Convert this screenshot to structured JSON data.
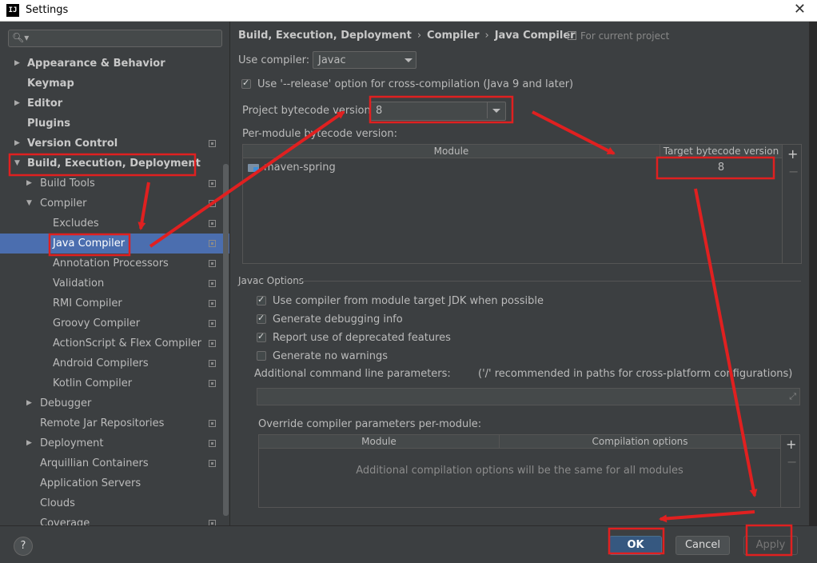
{
  "window": {
    "title": "Settings",
    "app_icon": "IJ"
  },
  "sidebar": {
    "search_placeholder": "",
    "items": [
      {
        "label": "Appearance & Behavior",
        "level": 0,
        "arrow": "right",
        "bold": true,
        "proj": false
      },
      {
        "label": "Keymap",
        "level": 0,
        "arrow": "",
        "bold": true,
        "proj": false
      },
      {
        "label": "Editor",
        "level": 0,
        "arrow": "right",
        "bold": true,
        "proj": false
      },
      {
        "label": "Plugins",
        "level": 0,
        "arrow": "",
        "bold": true,
        "proj": false
      },
      {
        "label": "Version Control",
        "level": 0,
        "arrow": "right",
        "bold": true,
        "proj": true
      },
      {
        "label": "Build, Execution, Deployment",
        "level": 0,
        "arrow": "down",
        "bold": true,
        "proj": false
      },
      {
        "label": "Build Tools",
        "level": 1,
        "arrow": "right",
        "bold": false,
        "proj": true
      },
      {
        "label": "Compiler",
        "level": 1,
        "arrow": "down",
        "bold": false,
        "proj": true
      },
      {
        "label": "Excludes",
        "level": 2,
        "arrow": "",
        "bold": false,
        "proj": true
      },
      {
        "label": "Java Compiler",
        "level": 2,
        "arrow": "",
        "bold": false,
        "proj": true,
        "selected": true
      },
      {
        "label": "Annotation Processors",
        "level": 2,
        "arrow": "",
        "bold": false,
        "proj": true
      },
      {
        "label": "Validation",
        "level": 2,
        "arrow": "",
        "bold": false,
        "proj": true
      },
      {
        "label": "RMI Compiler",
        "level": 2,
        "arrow": "",
        "bold": false,
        "proj": true
      },
      {
        "label": "Groovy Compiler",
        "level": 2,
        "arrow": "",
        "bold": false,
        "proj": true
      },
      {
        "label": "ActionScript & Flex Compiler",
        "level": 2,
        "arrow": "",
        "bold": false,
        "proj": true
      },
      {
        "label": "Android Compilers",
        "level": 2,
        "arrow": "",
        "bold": false,
        "proj": true
      },
      {
        "label": "Kotlin Compiler",
        "level": 2,
        "arrow": "",
        "bold": false,
        "proj": true
      },
      {
        "label": "Debugger",
        "level": 1,
        "arrow": "right",
        "bold": false,
        "proj": false
      },
      {
        "label": "Remote Jar Repositories",
        "level": 1,
        "arrow": "",
        "bold": false,
        "proj": true
      },
      {
        "label": "Deployment",
        "level": 1,
        "arrow": "right",
        "bold": false,
        "proj": true
      },
      {
        "label": "Arquillian Containers",
        "level": 1,
        "arrow": "",
        "bold": false,
        "proj": true
      },
      {
        "label": "Application Servers",
        "level": 1,
        "arrow": "",
        "bold": false,
        "proj": false
      },
      {
        "label": "Clouds",
        "level": 1,
        "arrow": "",
        "bold": false,
        "proj": false
      },
      {
        "label": "Coverage",
        "level": 1,
        "arrow": "",
        "bold": false,
        "proj": true
      }
    ]
  },
  "breadcrumb": {
    "parts": [
      "Build, Execution, Deployment",
      "Compiler",
      "Java Compiler"
    ],
    "separator": "›",
    "scope_label": "For current project"
  },
  "form": {
    "use_compiler_label": "Use compiler:",
    "use_compiler_value": "Javac",
    "release_option_label": "Use '--release' option for cross-compilation (Java 9 and later)",
    "release_option_checked": true,
    "bytecode_label": "Project bytecode version:",
    "bytecode_value": "8",
    "per_module_label": "Per-module bytecode version:",
    "module_table": {
      "columns": [
        "Module",
        "Target bytecode version"
      ],
      "rows": [
        {
          "module": "maven-spring",
          "target": "8"
        }
      ]
    },
    "javac_section_title": "Javac Options",
    "javac_options": [
      {
        "label": "Use compiler from module target JDK when possible",
        "checked": true
      },
      {
        "label": "Generate debugging info",
        "checked": true
      },
      {
        "label": "Report use of deprecated features",
        "checked": true
      },
      {
        "label": "Generate no warnings",
        "checked": false
      }
    ],
    "additional_params_label": "Additional command line parameters:",
    "additional_params_hint": "('/' recommended in paths for cross-platform configurations)",
    "additional_params_value": "",
    "override_label": "Override compiler parameters per-module:",
    "override_table": {
      "columns": [
        "Module",
        "Compilation options"
      ],
      "empty_text": "Additional compilation options will be the same for all modules"
    },
    "plus_symbol": "+",
    "minus_symbol": "−"
  },
  "buttons": {
    "help": "?",
    "ok": "OK",
    "cancel": "Cancel",
    "apply": "Apply"
  },
  "colors": {
    "accent": "#4b6eaf",
    "annotation": "#e02020",
    "background": "#3c3f41"
  }
}
